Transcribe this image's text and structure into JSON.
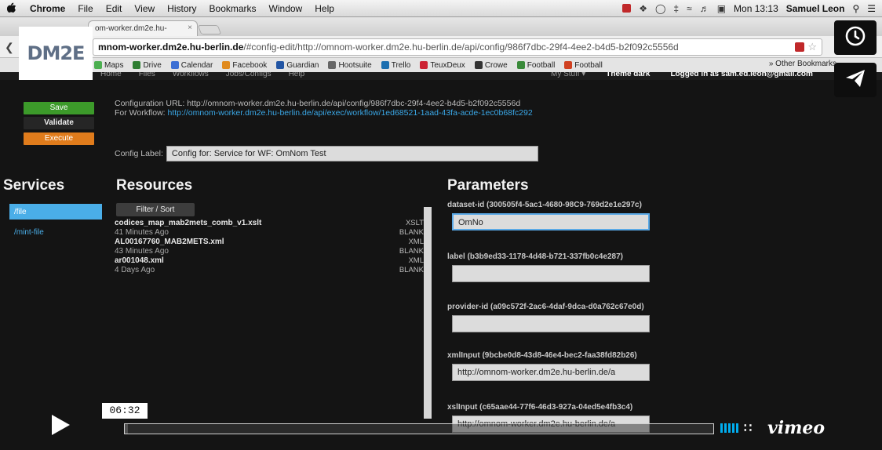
{
  "menubar": {
    "apple": "",
    "items": [
      "Chrome",
      "File",
      "Edit",
      "View",
      "History",
      "Bookmarks",
      "Window",
      "Help"
    ],
    "clock": "Mon 13:13",
    "user": "Samuel Leon"
  },
  "browser": {
    "tab_title": "om-worker.dm2e.hu-",
    "tab_close": "×",
    "url_host": "mnom-worker.dm2e.hu-berlin.de",
    "url_rest": "/#config-edit/http://omnom-worker.dm2e.hu-berlin.de/api/config/986f7dbc-29f4-4ee2-b4d5-b2f092c5556d",
    "bookmarks": [
      {
        "label": "Maps",
        "color": "#4caf50"
      },
      {
        "label": "Drive",
        "color": "#2e7d32"
      },
      {
        "label": "Calendar",
        "color": "#3b6fd4"
      },
      {
        "label": "Facebook",
        "color": "#e08a1e"
      },
      {
        "label": "Guardian",
        "color": "#2255a4"
      },
      {
        "label": "Hootsuite",
        "color": "#666666"
      },
      {
        "label": "Trello",
        "color": "#1c6fb0"
      },
      {
        "label": "TeuxDeux",
        "color": "#cc2233"
      },
      {
        "label": "Crowe",
        "color": "#333333"
      },
      {
        "label": "Football",
        "color": "#3a8a3a"
      },
      {
        "label": "Football",
        "color": "#d04020"
      }
    ],
    "other_bookmarks": "» Other Bookmarks"
  },
  "logo": "DM2E",
  "topnav": {
    "left": [
      "Home",
      "Files",
      "Workflows",
      "Jobs/Configs",
      "Help"
    ],
    "my_stuff": "My Stuff ▾",
    "theme": "Theme dark",
    "logged_in": "Logged in as sam.ed.leon@gmail.com"
  },
  "actions": {
    "save": "Save",
    "validate": "Validate",
    "execute": "Execute"
  },
  "config": {
    "url_label": "Configuration URL: http://omnom-worker.dm2e.hu-berlin.de/api/config/986f7dbc-29f4-4ee2-b4d5-b2f092c5556d",
    "workflow_prefix": "For Workflow: ",
    "workflow_link": "http://omnom-worker.dm2e.hu-berlin.de/api/exec/workflow/1ed68521-1aad-43fa-acde-1ec0b68fc292",
    "label_prefix": "Config Label:",
    "label_value": "Config for: Service for WF: OmNom Test"
  },
  "headings": {
    "services": "Services",
    "resources": "Resources",
    "parameters": "Parameters"
  },
  "services": [
    {
      "label": "/file",
      "active": true
    },
    {
      "label": "/mint-file",
      "active": false
    }
  ],
  "resources": {
    "filter_label": "Filter / Sort",
    "items": [
      {
        "name": "codices_map_mab2mets_comb_v1.xslt",
        "time": "41 Minutes Ago",
        "type1": "XSLT",
        "type2": "BLANK"
      },
      {
        "name": "AL00167760_MAB2METS.xml",
        "time": "43 Minutes Ago",
        "type1": "XML",
        "type2": "BLANK"
      },
      {
        "name": "ar001048.xml",
        "time": "4 Days Ago",
        "type1": "XML",
        "type2": "BLANK"
      }
    ]
  },
  "parameters": [
    {
      "label": "dataset-id (300505f4-5ac1-4680-98C9-769d2e1e297c)",
      "value": "OmNo",
      "focused": true
    },
    {
      "label": "label (b3b9ed33-1178-4d48-b721-337fb0c4e287)",
      "value": "",
      "focused": false
    },
    {
      "label": "provider-id (a09c572f-2ac6-4daf-9dca-d0a762c67e0d)",
      "value": "",
      "focused": false
    },
    {
      "label": "xmlInput (9bcbe0d8-43d8-46e4-bec2-faa38fd82b26)",
      "value": "http://omnom-worker.dm2e.hu-berlin.de/a",
      "focused": false
    },
    {
      "label": "xslInput (c65aae44-77f6-46d3-927a-04ed5e4fb3c4)",
      "value": "http://omnom-worker.dm2e.hu-berlin.de/a",
      "focused": false
    }
  ],
  "player": {
    "time": "06:32",
    "progress": 0.005,
    "brand": "vimeo",
    "accent": "#00adef"
  }
}
